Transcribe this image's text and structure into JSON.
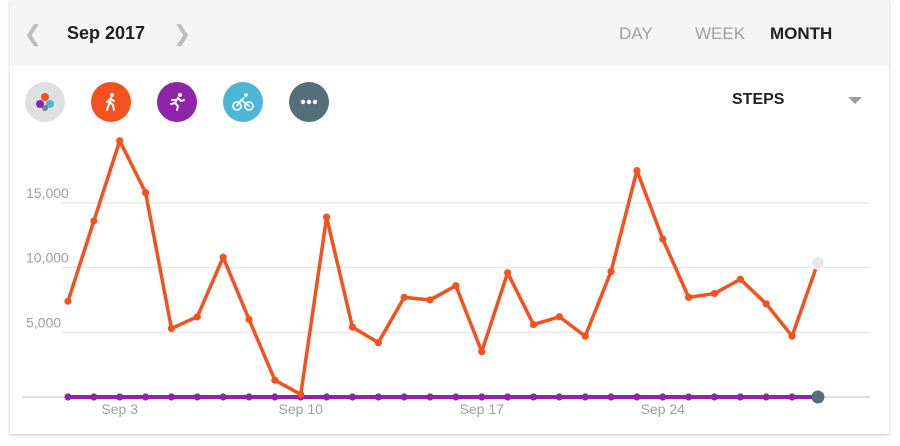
{
  "header": {
    "month_label": "Sep 2017",
    "prev_icon": "chevron-left-icon",
    "next_icon": "chevron-right-icon",
    "tabs": [
      {
        "label": "DAY",
        "active": false
      },
      {
        "label": "WEEK",
        "active": false
      },
      {
        "label": "MONTH",
        "active": true
      }
    ]
  },
  "activities": [
    {
      "name": "all-activities",
      "icon": "multi-dot-icon",
      "color": "#e0e0e0"
    },
    {
      "name": "walking",
      "icon": "walking-icon",
      "color": "#f4511e"
    },
    {
      "name": "running",
      "icon": "running-icon",
      "color": "#8e24aa"
    },
    {
      "name": "cycling",
      "icon": "cycling-icon",
      "color": "#4db6d6"
    },
    {
      "name": "more",
      "icon": "more-dots-icon",
      "color": "#546e7a"
    }
  ],
  "metric": {
    "label": "STEPS"
  },
  "colors": {
    "walking": "#f4511e",
    "running": "#8e24aa",
    "grid": "#e0e0e0",
    "axis_text": "#9e9e9e"
  },
  "chart_data": {
    "type": "line",
    "ylim": [
      0,
      20000
    ],
    "yticks": [
      "15,000",
      "10,000",
      "5,000"
    ],
    "ytick_values": [
      15000,
      10000,
      5000
    ],
    "xtick_labels": [
      "Sep 3",
      "Sep 10",
      "Sep 17",
      "Sep 24"
    ],
    "xtick_days": [
      3,
      10,
      17,
      24
    ],
    "x": [
      1,
      2,
      3,
      4,
      5,
      6,
      7,
      8,
      9,
      10,
      11,
      12,
      13,
      14,
      15,
      16,
      17,
      18,
      19,
      20,
      21,
      22,
      23,
      24,
      25,
      26,
      27,
      28,
      29,
      30
    ],
    "series": [
      {
        "key": "walking",
        "values": [
          7400,
          13600,
          19800,
          15800,
          5300,
          6200,
          10800,
          6000,
          1300,
          200,
          13900,
          5400,
          4200,
          7700,
          7500,
          8600,
          3500,
          9600,
          5600,
          6200,
          4700,
          9700,
          17500,
          12200,
          7700,
          8000,
          9100,
          7200,
          4700,
          10400
        ]
      },
      {
        "key": "running",
        "values": [
          0,
          0,
          0,
          0,
          0,
          0,
          0,
          0,
          0,
          0,
          0,
          0,
          0,
          0,
          0,
          0,
          0,
          0,
          0,
          0,
          0,
          0,
          0,
          0,
          0,
          0,
          0,
          0,
          0,
          0
        ]
      }
    ]
  }
}
